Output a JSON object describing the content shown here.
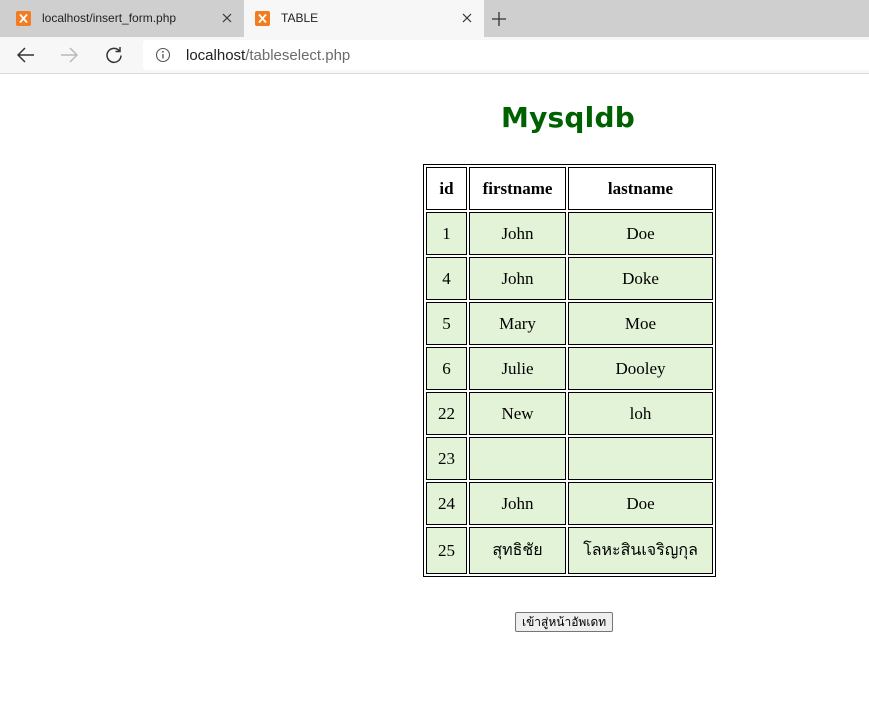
{
  "browser": {
    "tabs": [
      {
        "title": "localhost/insert_form.php",
        "active": false,
        "icon": "xampp-icon"
      },
      {
        "title": "TABLE",
        "active": true,
        "icon": "xampp-icon"
      }
    ],
    "address": {
      "host": "localhost",
      "path": "/tableselect.php"
    }
  },
  "page": {
    "heading": "Mysqldb",
    "heading_color": "#006100",
    "table": {
      "headers": [
        "id",
        "firstname",
        "lastname"
      ],
      "rows": [
        [
          "1",
          "John",
          "Doe"
        ],
        [
          "4",
          "John",
          "Doke"
        ],
        [
          "5",
          "Mary",
          "Moe"
        ],
        [
          "6",
          "Julie",
          "Dooley"
        ],
        [
          "22",
          "New",
          "loh"
        ],
        [
          "23",
          "",
          ""
        ],
        [
          "24",
          "John",
          "Doe"
        ],
        [
          "25",
          "สุทธิชัย",
          "โลหะสินเจริญกุล"
        ]
      ],
      "row_color": "#e2f3d7"
    },
    "update_button": "เข้าสู่หน้าอัพเดท"
  }
}
